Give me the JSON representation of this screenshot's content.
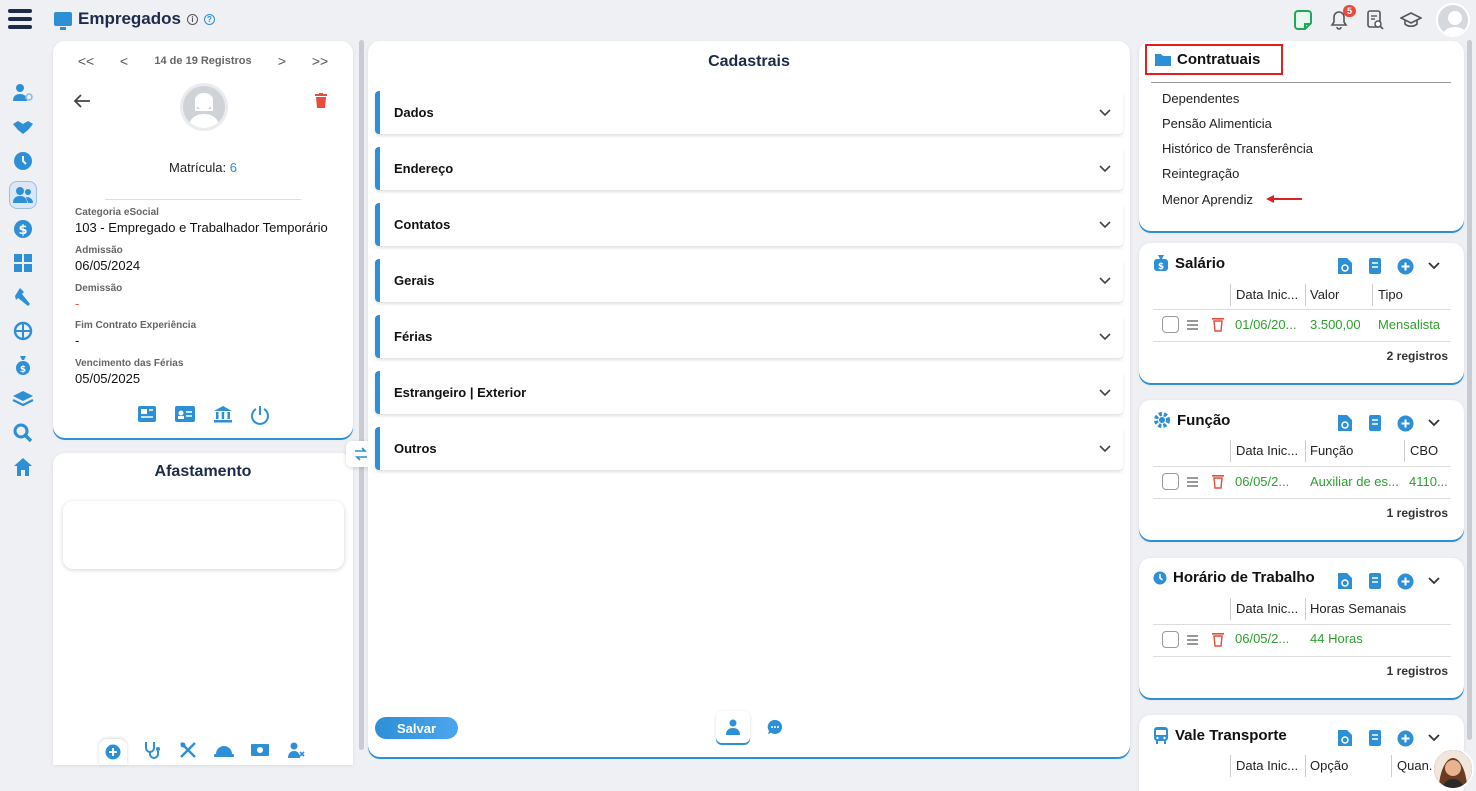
{
  "header": {
    "title": "Empregados",
    "notifications_count": "5"
  },
  "sidebar": {
    "items": [
      {
        "icon": "user-settings-icon"
      },
      {
        "icon": "handshake-icon"
      },
      {
        "icon": "clock-icon"
      },
      {
        "icon": "users-icon",
        "active": true
      },
      {
        "icon": "dollar-icon"
      },
      {
        "icon": "calculator-icon"
      },
      {
        "icon": "tools-icon"
      },
      {
        "icon": "network-icon"
      },
      {
        "icon": "money-bag-icon"
      },
      {
        "icon": "layers-icon"
      },
      {
        "icon": "search-icon"
      },
      {
        "icon": "home-icon"
      }
    ]
  },
  "employee": {
    "pager_first": "<<",
    "pager_prev": "<",
    "pager_text": "14 de 19 Registros",
    "pager_next": ">",
    "pager_last": ">>",
    "matricula_label": "Matrícula:",
    "matricula_value": "6",
    "fields": [
      {
        "label": "Categoria eSocial",
        "value": "103 - Empregado e Trabalhador Temporário"
      },
      {
        "label": "Admissão",
        "value": "06/05/2024"
      },
      {
        "label": "Demissão",
        "value": "-"
      },
      {
        "label": "Fim Contrato Experiência",
        "value": "-"
      },
      {
        "label": "Vencimento das Férias",
        "value": "05/05/2025"
      }
    ]
  },
  "afastamento": {
    "title": "Afastamento"
  },
  "cadastrais": {
    "title": "Cadastrais",
    "sections": [
      "Dados",
      "Endereço",
      "Contatos",
      "Gerais",
      "Férias",
      "Estrangeiro | Exterior",
      "Outros"
    ],
    "save_label": "Salvar"
  },
  "contratuais": {
    "title": "Contratuais",
    "links": [
      "Dependentes",
      "Pensão Alimenticia",
      "Histórico de Transferência",
      "Reintegração",
      "Menor Aprendiz"
    ]
  },
  "salario": {
    "title": "Salário",
    "columns": [
      "Data Inic...",
      "Valor",
      "Tipo"
    ],
    "row": [
      "01/06/20...",
      "3.500,00",
      "Mensalista"
    ],
    "count": "2 registros"
  },
  "funcao": {
    "title": "Função",
    "columns": [
      "Data Inic...",
      "Função",
      "CBO"
    ],
    "row": [
      "06/05/2...",
      "Auxiliar de es...",
      "4110..."
    ],
    "count": "1 registros"
  },
  "horario": {
    "title": "Horário de Trabalho",
    "columns": [
      "Data Inic...",
      "Horas Semanais"
    ],
    "row": [
      "06/05/2...",
      "44 Horas"
    ],
    "count": "1 registros"
  },
  "vale": {
    "title": "Vale Transporte",
    "columns": [
      "Data Inic...",
      "Opção",
      "Quan..."
    ]
  },
  "colors": {
    "accent": "#2d8fd6",
    "navy": "#1e2a4a",
    "green": "#2fa02f",
    "red": "#e74c3c"
  }
}
